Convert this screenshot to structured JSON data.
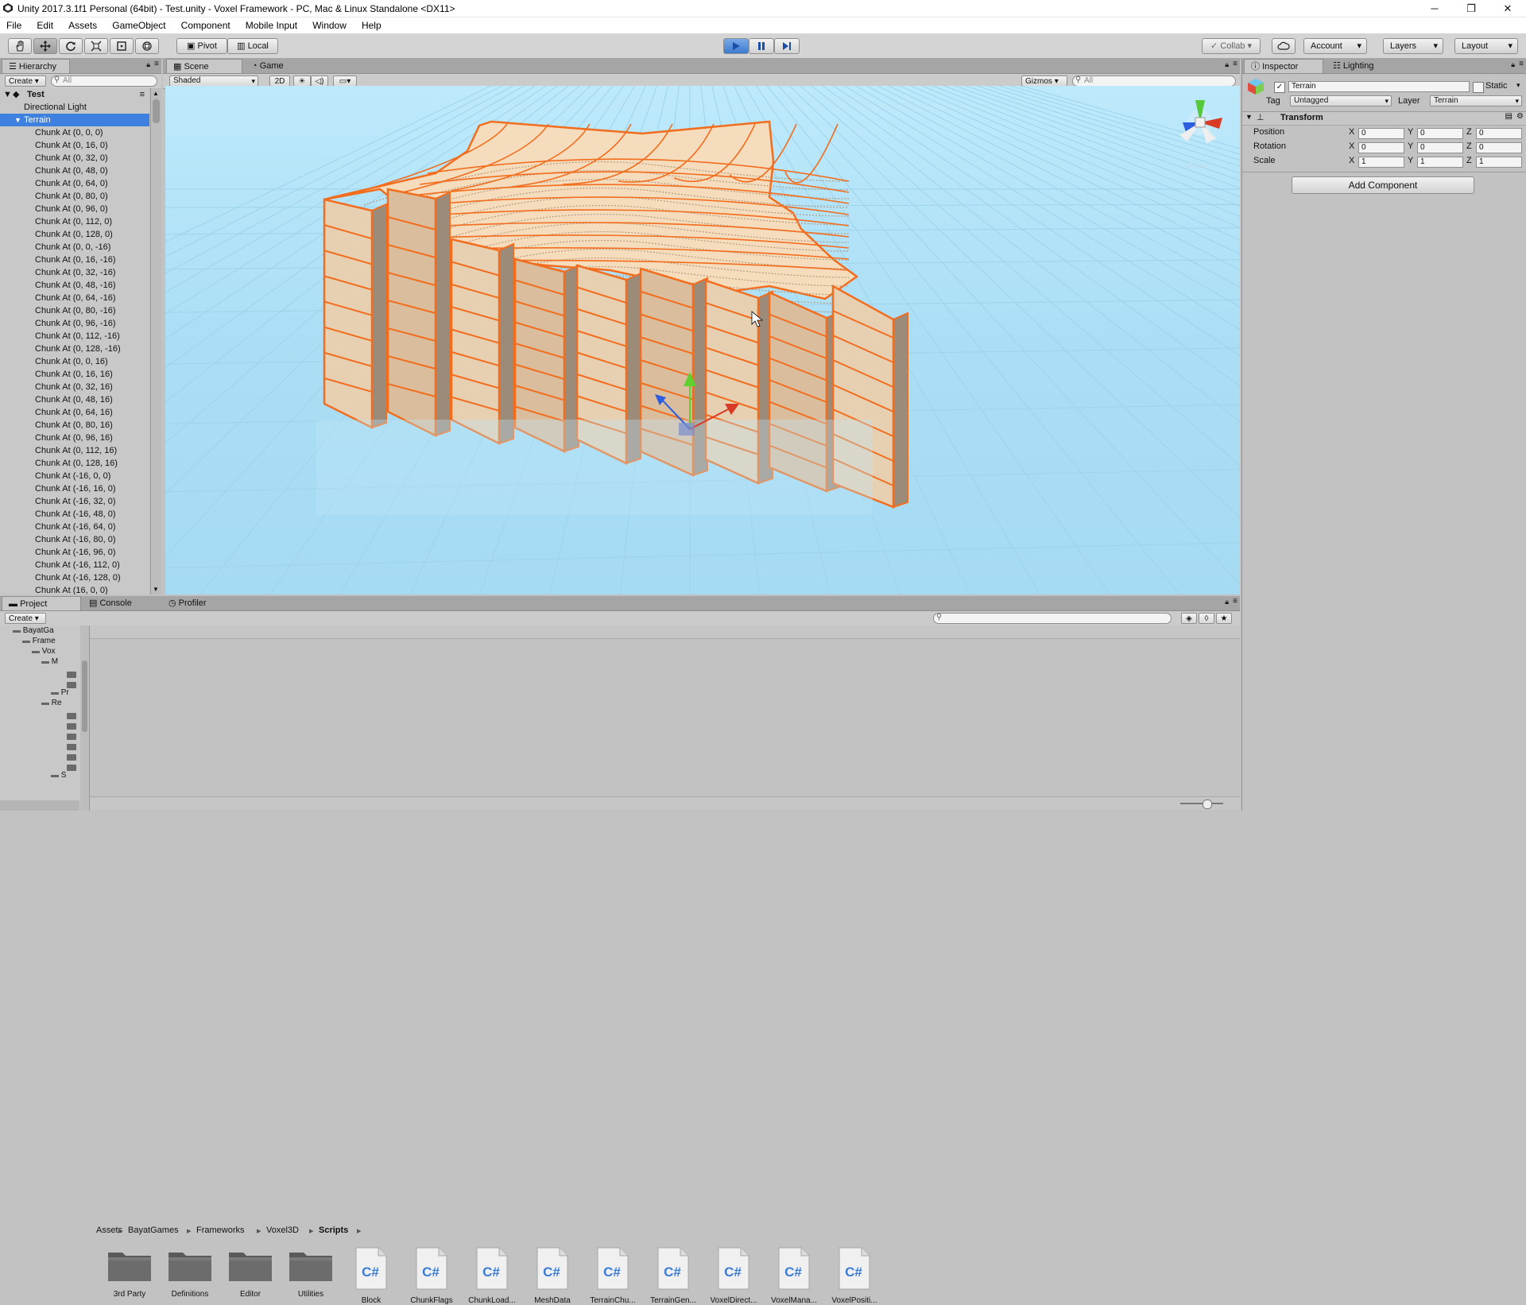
{
  "window": {
    "title": "Unity 2017.3.1f1 Personal (64bit) - Test.unity - Voxel Framework - PC, Mac & Linux Standalone <DX11>",
    "minimize": "─",
    "maximize": "❐",
    "close": "✕"
  },
  "menu": [
    "File",
    "Edit",
    "Assets",
    "GameObject",
    "Component",
    "Mobile Input",
    "Window",
    "Help"
  ],
  "toolbar": {
    "pivot": "Pivot",
    "local": "Local",
    "collab": "Collab ▾",
    "account": "Account",
    "layers": "Layers",
    "layout": "Layout"
  },
  "hierarchy": {
    "tab": "Hierarchy",
    "create": "Create ▾",
    "search_placeholder": "All",
    "scene": "Test",
    "items": [
      "Directional Light",
      "Terrain",
      "Chunk At (0, 0, 0)",
      "Chunk At (0, 16, 0)",
      "Chunk At (0, 32, 0)",
      "Chunk At (0, 48, 0)",
      "Chunk At (0, 64, 0)",
      "Chunk At (0, 80, 0)",
      "Chunk At (0, 96, 0)",
      "Chunk At (0, 112, 0)",
      "Chunk At (0, 128, 0)",
      "Chunk At (0, 0, -16)",
      "Chunk At (0, 16, -16)",
      "Chunk At (0, 32, -16)",
      "Chunk At (0, 48, -16)",
      "Chunk At (0, 64, -16)",
      "Chunk At (0, 80, -16)",
      "Chunk At (0, 96, -16)",
      "Chunk At (0, 112, -16)",
      "Chunk At (0, 128, -16)",
      "Chunk At (0, 0, 16)",
      "Chunk At (0, 16, 16)",
      "Chunk At (0, 32, 16)",
      "Chunk At (0, 48, 16)",
      "Chunk At (0, 64, 16)",
      "Chunk At (0, 80, 16)",
      "Chunk At (0, 96, 16)",
      "Chunk At (0, 112, 16)",
      "Chunk At (0, 128, 16)",
      "Chunk At (-16, 0, 0)",
      "Chunk At (-16, 16, 0)",
      "Chunk At (-16, 32, 0)",
      "Chunk At (-16, 48, 0)",
      "Chunk At (-16, 64, 0)",
      "Chunk At (-16, 80, 0)",
      "Chunk At (-16, 96, 0)",
      "Chunk At (-16, 112, 0)",
      "Chunk At (-16, 128, 0)",
      "Chunk At (16, 0, 0)"
    ]
  },
  "scene": {
    "tab_scene": "Scene",
    "tab_game": "Game",
    "shading": "Shaded",
    "mode_2d": "2D",
    "gizmos": "Gizmos",
    "search_placeholder": "All",
    "persp": "Persp",
    "colors": {
      "sky": "#abdef5",
      "outline": "#f26d1d",
      "voxel": "#f5dcbc"
    }
  },
  "inspector": {
    "tab": "Inspector",
    "tab_lighting": "Lighting",
    "object_name": "Terrain",
    "static_label": "Static",
    "tag_label": "Tag",
    "tag_value": "Untagged",
    "layer_label": "Layer",
    "layer_value": "Terrain",
    "transform": "Transform",
    "position_label": "Position",
    "rotation_label": "Rotation",
    "scale_label": "Scale",
    "axis_x": "X",
    "axis_y": "Y",
    "axis_z": "Z",
    "position": [
      "0",
      "0",
      "0"
    ],
    "rotation": [
      "0",
      "0",
      "0"
    ],
    "scale": [
      "1",
      "1",
      "1"
    ],
    "add_component": "Add Component"
  },
  "bottom": {
    "tab_project": "Project",
    "tab_console": "Console",
    "tab_profiler": "Profiler",
    "create": "Create ▾",
    "tree": [
      "BayatGa",
      "Frame",
      "Vox",
      "M",
      "Pr",
      "Re",
      "S"
    ],
    "breadcrumb": [
      "Assets",
      "BayatGames",
      "Frameworks",
      "Voxel3D",
      "Scripts"
    ],
    "assets": [
      {
        "name": "3rd Party",
        "kind": "folder"
      },
      {
        "name": "Definitions",
        "kind": "folder"
      },
      {
        "name": "Editor",
        "kind": "folder"
      },
      {
        "name": "Utilities",
        "kind": "folder"
      },
      {
        "name": "Block",
        "kind": "script"
      },
      {
        "name": "ChunkFlags",
        "kind": "script"
      },
      {
        "name": "ChunkLoad...",
        "kind": "script"
      },
      {
        "name": "MeshData",
        "kind": "script"
      },
      {
        "name": "TerrainChu...",
        "kind": "script"
      },
      {
        "name": "TerrainGen...",
        "kind": "script"
      },
      {
        "name": "VoxelDirect...",
        "kind": "script"
      },
      {
        "name": "VoxelMana...",
        "kind": "script"
      },
      {
        "name": "VoxelPositi...",
        "kind": "script"
      }
    ],
    "script_glyph": "C#"
  }
}
